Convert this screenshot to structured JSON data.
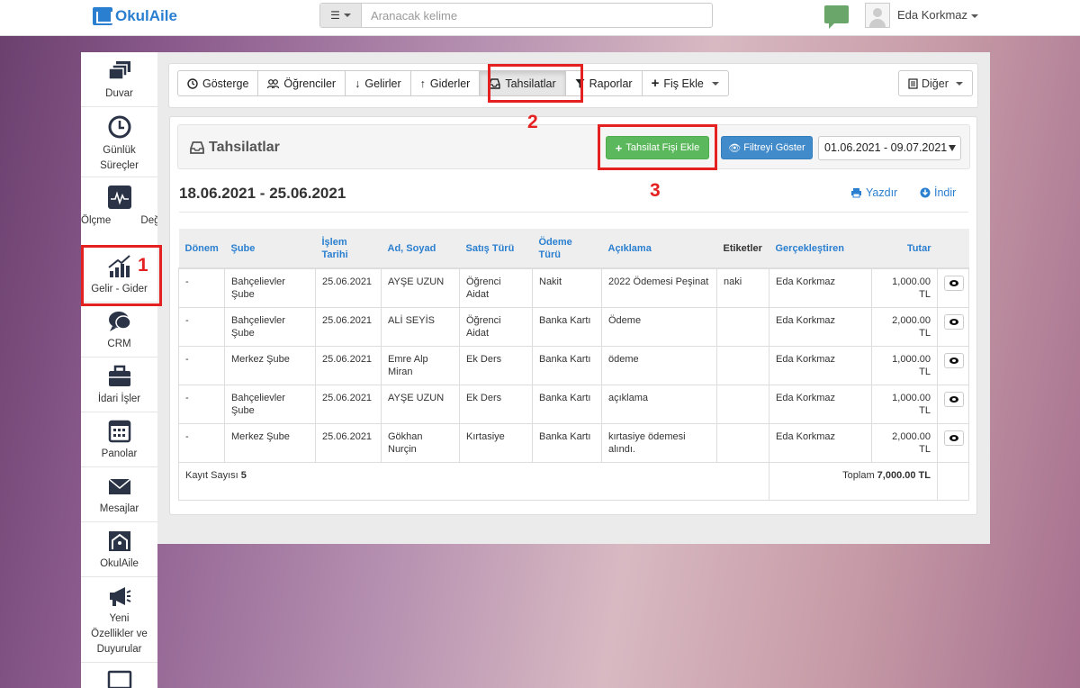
{
  "header": {
    "logo_text": "OkulAile",
    "search_placeholder": "Aranacak kelime",
    "user_name": "Eda Korkmaz"
  },
  "sidebar": {
    "items": [
      {
        "label": "Duvar",
        "icon": "dashboard-icon"
      },
      {
        "label": "Günlük Süreçler",
        "icon": "clock-icon"
      },
      {
        "label": "Ölçme Değerlendirme",
        "icon": "pulse-chart-icon"
      },
      {
        "label": "Gelir - Gider",
        "icon": "rising-chart-icon"
      },
      {
        "label": "CRM",
        "icon": "chat-bubbles-icon"
      },
      {
        "label": "İdari İşler",
        "icon": "briefcase-icon"
      },
      {
        "label": "Panolar",
        "icon": "calendar-icon"
      },
      {
        "label": "Mesajlar",
        "icon": "envelope-icon"
      },
      {
        "label": "OkulAile",
        "icon": "okulaile-logo-icon"
      },
      {
        "label": "Yeni Özellikler ve Duyurular",
        "icon": "megaphone-icon"
      }
    ]
  },
  "toolbar": {
    "tabs": [
      {
        "label": "Gösterge",
        "icon": "dashboard-icon"
      },
      {
        "label": "Öğrenciler",
        "icon": "users-icon"
      },
      {
        "label": "Gelirler",
        "icon": "arrow-down-icon"
      },
      {
        "label": "Giderler",
        "icon": "arrow-up-icon"
      },
      {
        "label": "Tahsilatlar",
        "icon": "inbox-icon"
      },
      {
        "label": "Raporlar",
        "icon": "filter-icon"
      },
      {
        "label": "Fiş Ekle",
        "icon": "plus-icon"
      }
    ],
    "other_label": "Diğer"
  },
  "panel": {
    "title": "Tahsilatlar",
    "add_button": "Tahsilat Fişi Ekle",
    "filter_button": "Filtreyi Göster",
    "date_range_select": "01.06.2021 - 09.07.2021",
    "range_title": "18.06.2021 - 25.06.2021",
    "print_label": "Yazdır",
    "download_label": "İndir"
  },
  "table": {
    "headers": [
      "Dönem",
      "Şube",
      "İşlem Tarihi",
      "Ad, Soyad",
      "Satış Türü",
      "Ödeme Türü",
      "Açıklama",
      "Etiketler",
      "Gerçekleştiren",
      "Tutar"
    ],
    "rows": [
      {
        "donem": "-",
        "sube": "Bahçelievler Şube",
        "tarih": "25.06.2021",
        "ad": "AYŞE UZUN",
        "satis": "Öğrenci Aidat",
        "odeme": "Nakit",
        "aciklama": "2022 Ödemesi Peşinat",
        "etiket": "naki",
        "gerceklestiren": "Eda Korkmaz",
        "tutar": "1,000.00 TL"
      },
      {
        "donem": "-",
        "sube": "Bahçelievler Şube",
        "tarih": "25.06.2021",
        "ad": "ALİ SEYİS",
        "satis": "Öğrenci Aidat",
        "odeme": "Banka Kartı",
        "aciklama": "Ödeme",
        "etiket": "",
        "gerceklestiren": "Eda Korkmaz",
        "tutar": "2,000.00 TL"
      },
      {
        "donem": "-",
        "sube": "Merkez Şube",
        "tarih": "25.06.2021",
        "ad": "Emre Alp Miran",
        "satis": "Ek Ders",
        "odeme": "Banka Kartı",
        "aciklama": "ödeme",
        "etiket": "",
        "gerceklestiren": "Eda Korkmaz",
        "tutar": "1,000.00 TL"
      },
      {
        "donem": "-",
        "sube": "Bahçelievler Şube",
        "tarih": "25.06.2021",
        "ad": "AYŞE UZUN",
        "satis": "Ek Ders",
        "odeme": "Banka Kartı",
        "aciklama": "açıklama",
        "etiket": "",
        "gerceklestiren": "Eda Korkmaz",
        "tutar": "1,000.00 TL"
      },
      {
        "donem": "-",
        "sube": "Merkez Şube",
        "tarih": "25.06.2021",
        "ad": "Gökhan Nurçin",
        "satis": "Kırtasiye",
        "odeme": "Banka Kartı",
        "aciklama": "kırtasiye ödemesi alındı.",
        "etiket": "",
        "gerceklestiren": "Eda Korkmaz",
        "tutar": "2,000.00 TL"
      }
    ],
    "footer": {
      "count_label": "Kayıt Sayısı",
      "count_value": "5",
      "total_label": "Toplam",
      "total_value": "7,000.00 TL"
    }
  },
  "annotations": {
    "marker_1": "1",
    "marker_2": "2",
    "marker_3": "3",
    "highlight_color": "#e52020"
  },
  "colors": {
    "brand": "#2a7fd0",
    "success": "#5cb85c",
    "primary": "#428bca"
  }
}
